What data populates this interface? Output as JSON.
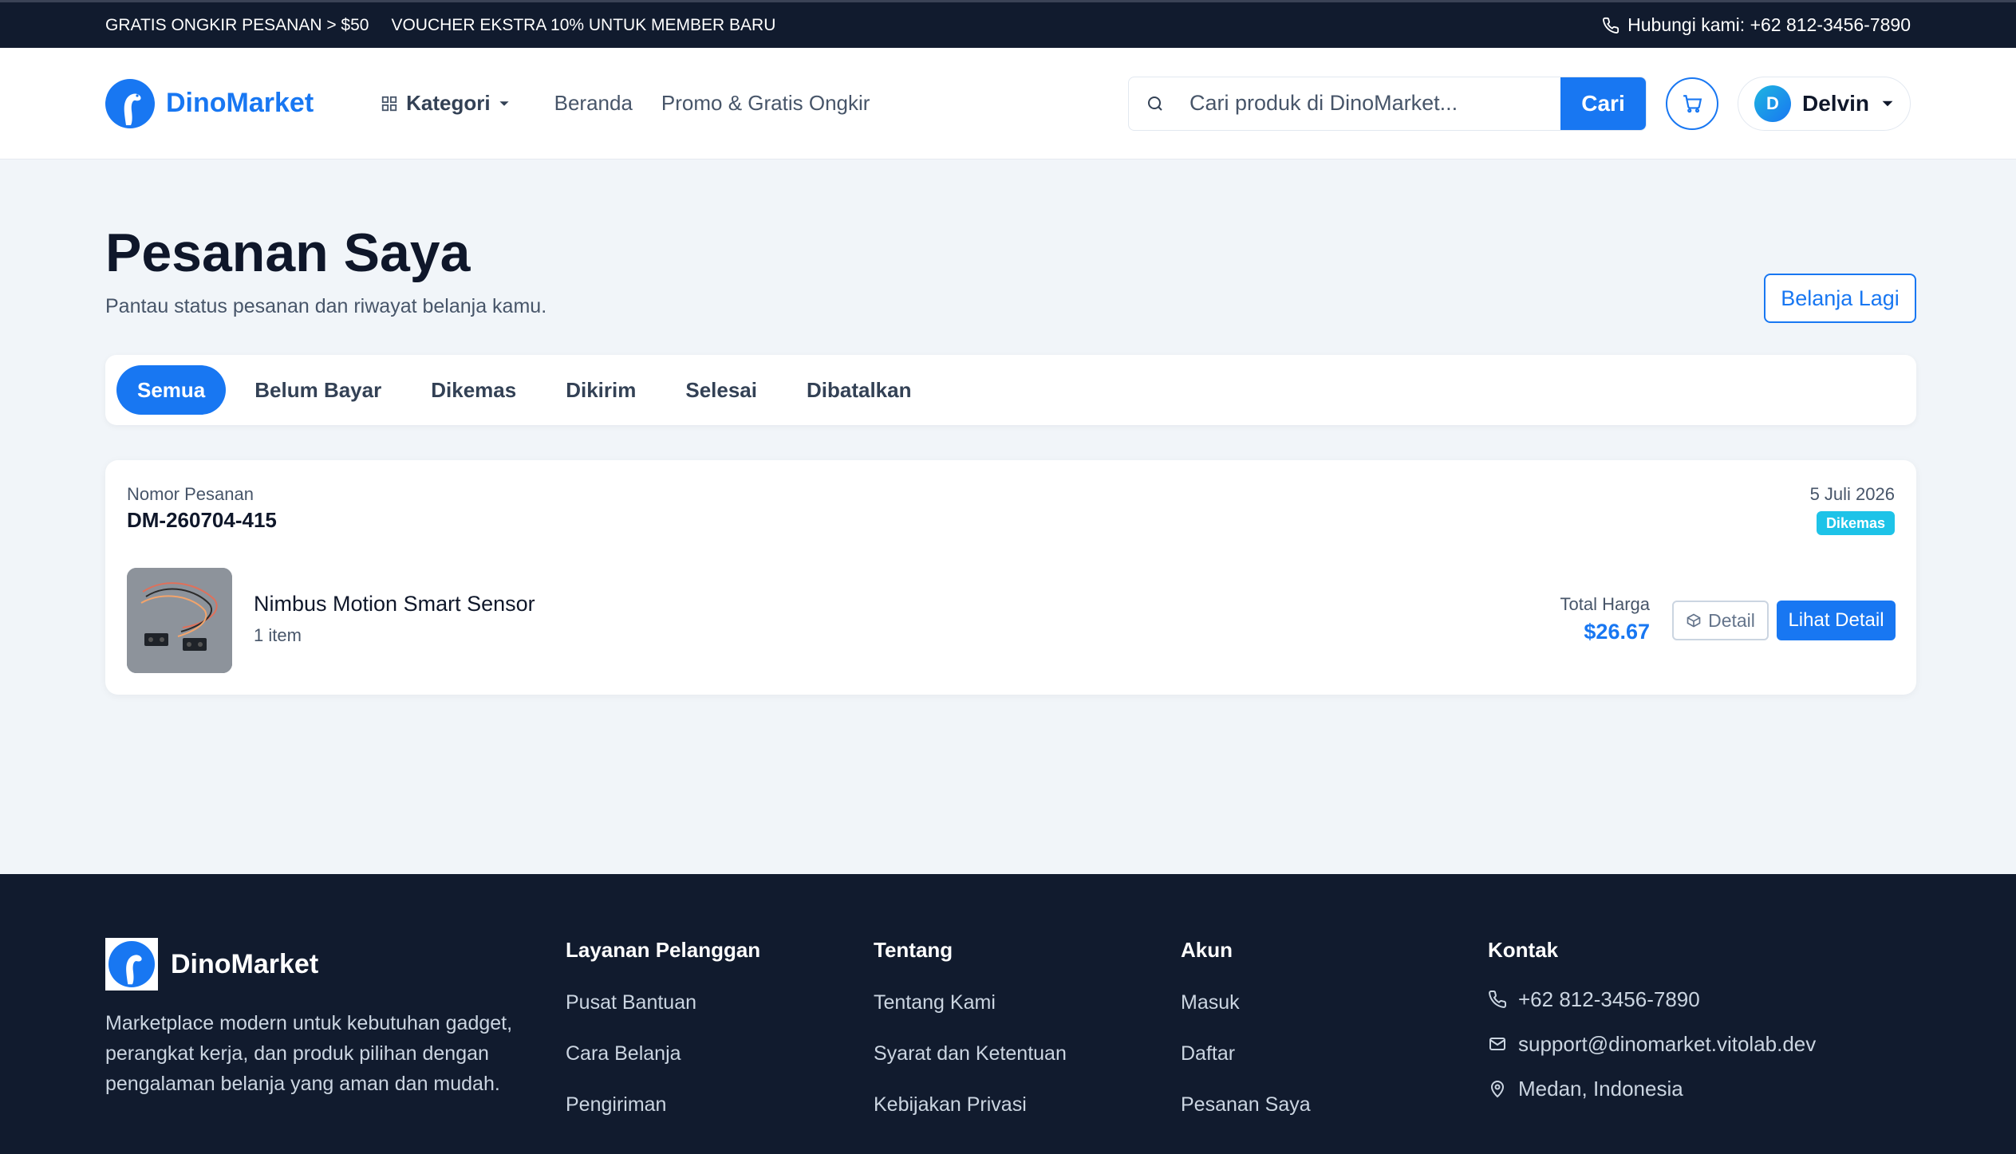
{
  "topbar": {
    "promo1": "GRATIS ONGKIR PESANAN > $50",
    "promo2": "VOUCHER EKSTRA 10% UNTUK MEMBER BARU",
    "contact": "Hubungi kami: +62 812-3456-7890"
  },
  "header": {
    "brand": "DinoMarket",
    "nav": {
      "kategori": "Kategori",
      "beranda": "Beranda",
      "promo": "Promo & Gratis Ongkir"
    },
    "search": {
      "placeholder": "Cari produk di DinoMarket...",
      "button": "Cari"
    },
    "user": {
      "initial": "D",
      "name": "Delvin"
    }
  },
  "page": {
    "title": "Pesanan Saya",
    "subtitle": "Pantau status pesanan dan riwayat belanja kamu.",
    "shop_again": "Belanja Lagi"
  },
  "tabs": [
    {
      "label": "Semua",
      "active": true
    },
    {
      "label": "Belum Bayar",
      "active": false
    },
    {
      "label": "Dikemas",
      "active": false
    },
    {
      "label": "Dikirim",
      "active": false
    },
    {
      "label": "Selesai",
      "active": false
    },
    {
      "label": "Dibatalkan",
      "active": false
    }
  ],
  "order": {
    "number_label": "Nomor Pesanan",
    "number": "DM-260704-415",
    "date": "5 Juli 2026",
    "status": "Dikemas",
    "product_name": "Nimbus Motion Smart Sensor",
    "quantity": "1 item",
    "total_label": "Total Harga",
    "total": "$26.67",
    "detail_button": "Detail",
    "view_detail_button": "Lihat Detail"
  },
  "footer": {
    "brand": "DinoMarket",
    "description": "Marketplace modern untuk kebutuhan gadget, perangkat kerja, dan produk pilihan dengan pengalaman belanja yang aman dan mudah.",
    "columns": [
      {
        "title": "Layanan Pelanggan",
        "items": [
          "Pusat Bantuan",
          "Cara Belanja",
          "Pengiriman"
        ]
      },
      {
        "title": "Tentang",
        "items": [
          "Tentang Kami",
          "Syarat dan Ketentuan",
          "Kebijakan Privasi"
        ]
      },
      {
        "title": "Akun",
        "items": [
          "Masuk",
          "Daftar",
          "Pesanan Saya"
        ]
      }
    ],
    "contact": {
      "title": "Kontak",
      "phone": "+62 812-3456-7890",
      "email": "support@dinomarket.vitolab.dev",
      "location": "Medan, Indonesia"
    }
  },
  "colors": {
    "primary": "#1877f2",
    "dark": "#111b2e",
    "status": "#1ec3e8"
  }
}
